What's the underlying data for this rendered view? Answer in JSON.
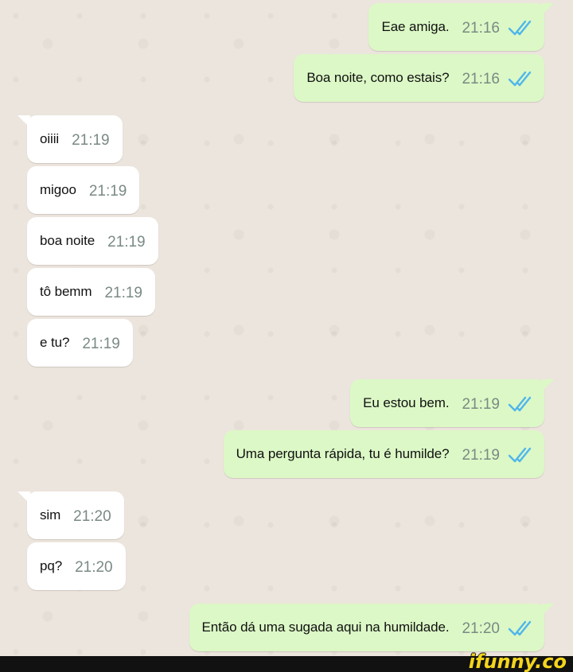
{
  "messages": [
    {
      "dir": "out",
      "text": "Eae amiga.",
      "time": "21:16",
      "read": true
    },
    {
      "dir": "out",
      "text": "Boa noite, como estais?",
      "time": "21:16",
      "read": true
    },
    {
      "dir": "in",
      "text": "oiiii",
      "time": "21:19"
    },
    {
      "dir": "in",
      "text": "migoo",
      "time": "21:19"
    },
    {
      "dir": "in",
      "text": "boa noite",
      "time": "21:19"
    },
    {
      "dir": "in",
      "text": "tô bemm",
      "time": "21:19"
    },
    {
      "dir": "in",
      "text": "e tu?",
      "time": "21:19"
    },
    {
      "dir": "out",
      "text": "Eu estou bem.",
      "time": "21:19",
      "read": true
    },
    {
      "dir": "out",
      "text": "Uma pergunta rápida, tu é humilde?",
      "time": "21:19",
      "read": true
    },
    {
      "dir": "in",
      "text": "sim",
      "time": "21:20"
    },
    {
      "dir": "in",
      "text": "pq?",
      "time": "21:20"
    },
    {
      "dir": "out",
      "text": "Então dá uma sugada aqui na humildade.",
      "time": "21:20",
      "read": true
    }
  ],
  "watermark": "ifunny.co",
  "colors": {
    "outgoing": "#dcf8c6",
    "incoming": "#ffffff",
    "read_check": "#4fb6ec",
    "background": "#ece5dd"
  }
}
